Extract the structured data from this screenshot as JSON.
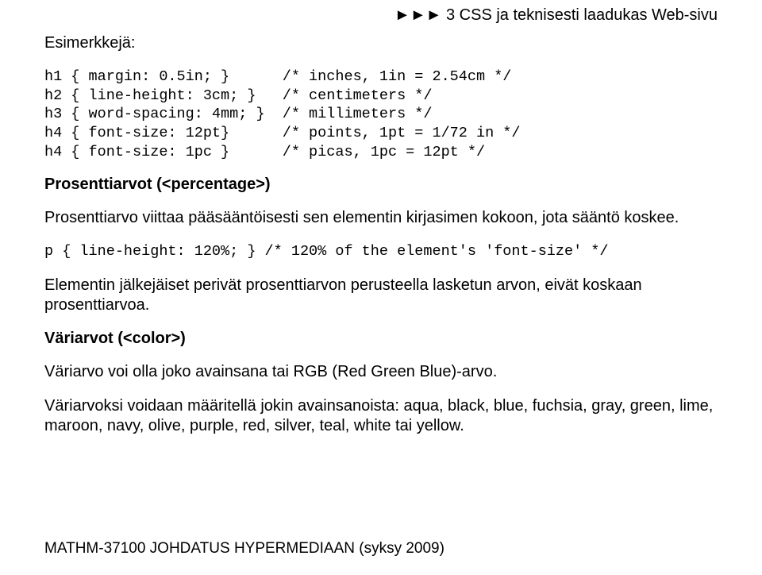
{
  "header": {
    "arrows": "►►►",
    "text": "3 CSS ja teknisesti laadukas Web-sivu"
  },
  "body": {
    "examplesHeading": "Esimerkkejä:",
    "code1": "h1 { margin: 0.5in; }      /* inches, 1in = 2.54cm */\nh2 { line-height: 3cm; }   /* centimeters */\nh3 { word-spacing: 4mm; }  /* millimeters */\nh4 { font-size: 12pt}      /* points, 1pt = 1/72 in */\nh4 { font-size: 1pc }      /* picas, 1pc = 12pt */",
    "percentHeading": "Prosenttiarvot (<percentage>)",
    "percentPara": "Prosenttiarvo viittaa pääsääntöisesti sen elementin kirjasimen kokoon, jota sääntö koskee.",
    "code2": "p { line-height: 120%; } /* 120% of the element's 'font-size' */",
    "inheritPara": "Elementin jälkejäiset perivät prosenttiarvon perusteella lasketun arvon, eivät koskaan prosenttiarvoa.",
    "colorHeading": "Väriarvot (<color>)",
    "colorPara1": "Väriarvo voi olla joko avainsana tai RGB (Red Green Blue)-arvo.",
    "colorPara2": "Väriarvoksi voidaan määritellä jokin avainsanoista: aqua, black, blue, fuchsia, gray, green, lime, maroon, navy, olive, purple, red, silver, teal, white tai yellow."
  },
  "footer": {
    "text": "MATHM-37100 JOHDATUS HYPERMEDIAAN (syksy 2009)"
  }
}
